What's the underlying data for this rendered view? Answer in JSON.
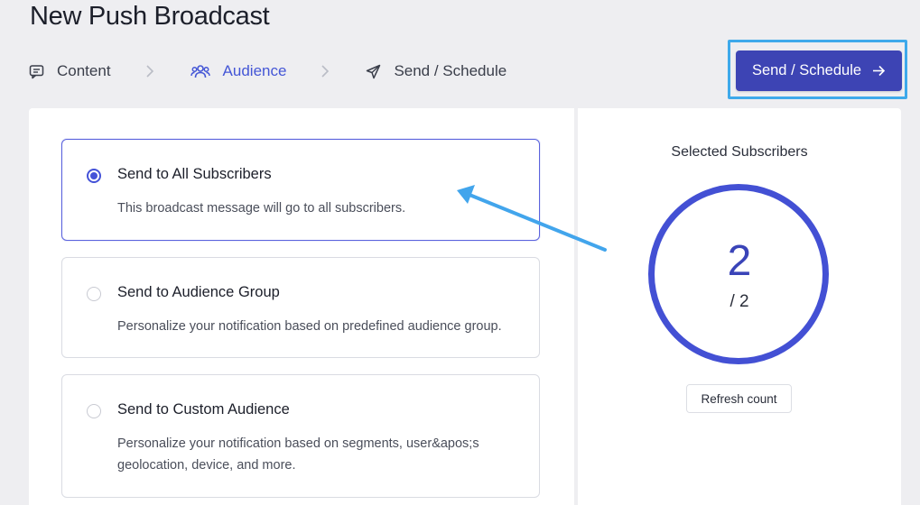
{
  "page": {
    "title": "New Push Broadcast"
  },
  "steps": [
    {
      "label": "Content",
      "icon": "message-icon"
    },
    {
      "label": "Audience",
      "icon": "users-icon",
      "active": true
    },
    {
      "label": "Send / Schedule",
      "icon": "send-icon"
    }
  ],
  "actions": {
    "send_schedule_label": "Send / Schedule",
    "send_schedule_icon": "arrow-right-icon"
  },
  "audience_options": [
    {
      "title": "Send to All Subscribers",
      "description": "This broadcast message will go to all subscribers.",
      "selected": true
    },
    {
      "title": "Send to Audience Group",
      "description": "Personalize your notification based on predefined audience group.",
      "selected": false
    },
    {
      "title": "Send to Custom Audience",
      "description": "Personalize your notification based on segments, user&apos;s geolocation, device, and more.",
      "selected": false
    }
  ],
  "subscribers": {
    "label": "Selected Subscribers",
    "selected": "2",
    "total": "/ 2",
    "refresh_label": "Refresh count"
  },
  "colors": {
    "accent": "#4452d8",
    "button": "#3d44b4",
    "highlight": "#3ea9ea",
    "background": "#eeeef1"
  }
}
